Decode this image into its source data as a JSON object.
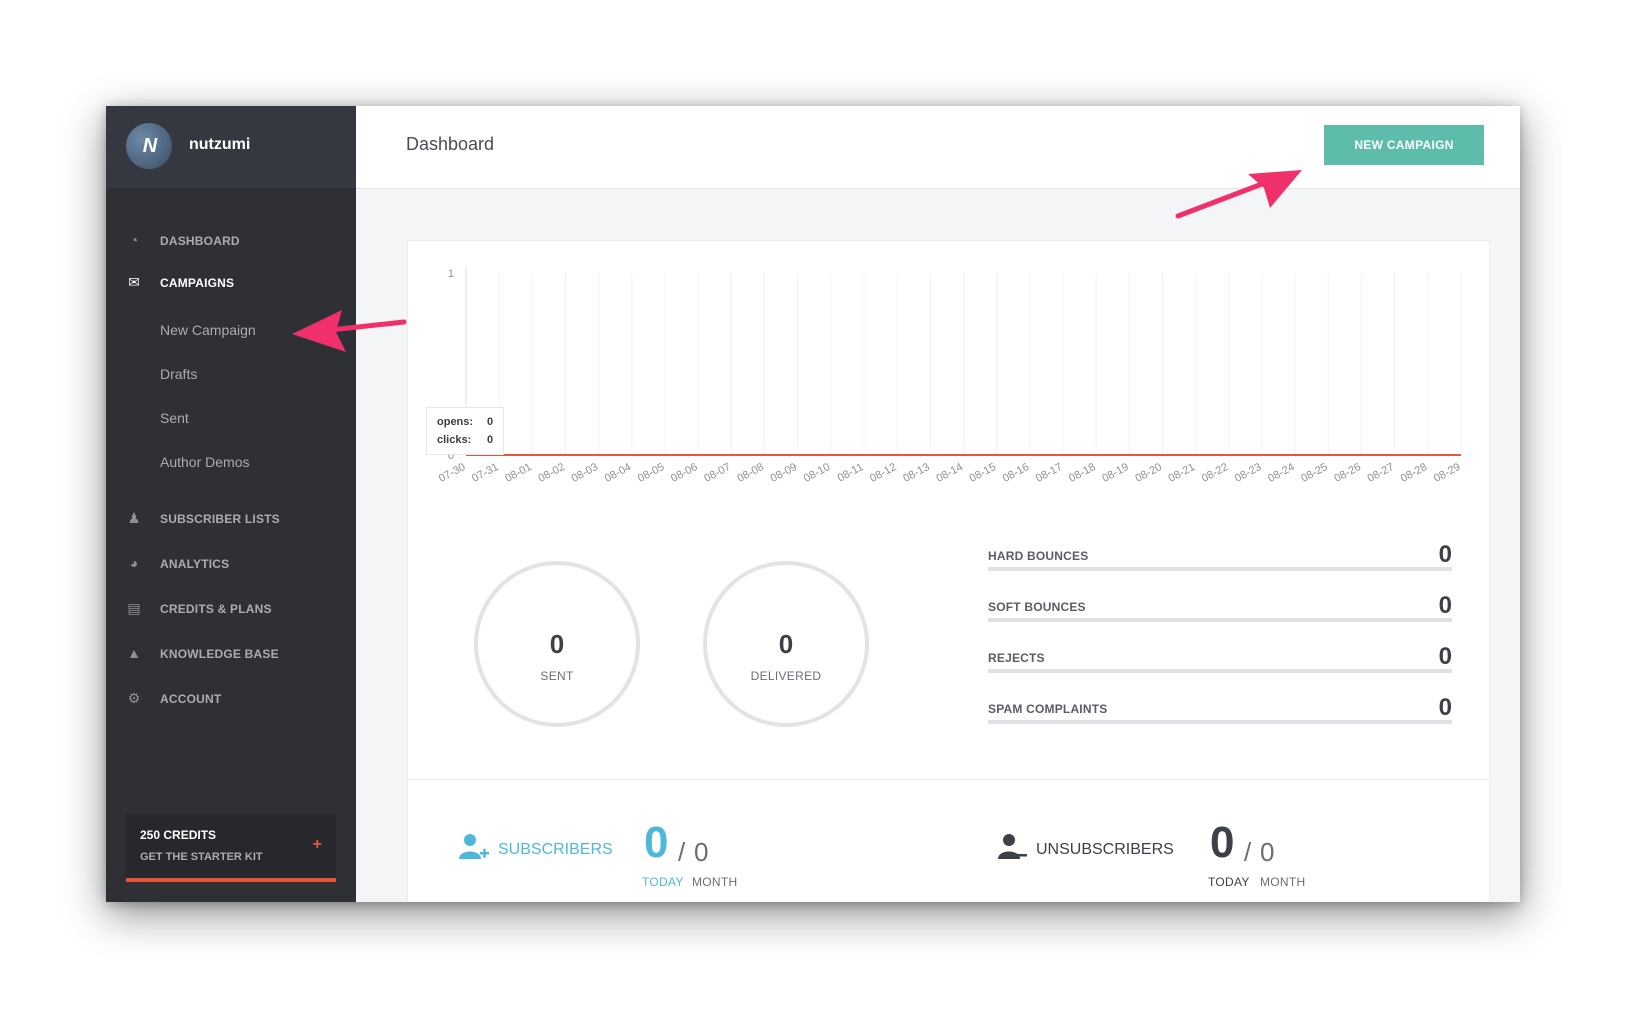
{
  "brand": {
    "logo_text": "N",
    "name": "nutzumi"
  },
  "sidebar": {
    "items": [
      {
        "icon": "dashboard-icon",
        "glyph": "◔",
        "label": "DASHBOARD"
      },
      {
        "icon": "envelope-icon",
        "glyph": "✉",
        "label": "CAMPAIGNS"
      },
      {
        "icon": "users-icon",
        "glyph": "♟",
        "label": "SUBSCRIBER LISTS"
      },
      {
        "icon": "pie-chart-icon",
        "glyph": "◕",
        "label": "ANALYTICS"
      },
      {
        "icon": "wallet-icon",
        "glyph": "▤",
        "label": "CREDITS & PLANS"
      },
      {
        "icon": "graduation-cap-icon",
        "glyph": "▲",
        "label": "KNOWLEDGE BASE"
      },
      {
        "icon": "gear-icon",
        "glyph": "⚙",
        "label": "ACCOUNT"
      }
    ],
    "campaign_subitems": [
      "New Campaign",
      "Drafts",
      "Sent",
      "Author Demos"
    ],
    "credits": {
      "title": "250 CREDITS",
      "subtitle": "GET THE STARTER KIT",
      "plus": "+"
    }
  },
  "header": {
    "title": "Dashboard",
    "new_campaign_label": "NEW CAMPAIGN"
  },
  "chart_data": {
    "type": "line",
    "categories": [
      "07-30",
      "07-31",
      "08-01",
      "08-02",
      "08-03",
      "08-04",
      "08-05",
      "08-06",
      "08-07",
      "08-08",
      "08-09",
      "08-10",
      "08-11",
      "08-12",
      "08-13",
      "08-14",
      "08-15",
      "08-16",
      "08-17",
      "08-18",
      "08-19",
      "08-20",
      "08-21",
      "08-22",
      "08-23",
      "08-24",
      "08-25",
      "08-26",
      "08-27",
      "08-28",
      "08-29"
    ],
    "series": [
      {
        "name": "opens",
        "values": [
          0,
          0,
          0,
          0,
          0,
          0,
          0,
          0,
          0,
          0,
          0,
          0,
          0,
          0,
          0,
          0,
          0,
          0,
          0,
          0,
          0,
          0,
          0,
          0,
          0,
          0,
          0,
          0,
          0,
          0,
          0
        ]
      },
      {
        "name": "clicks",
        "values": [
          0,
          0,
          0,
          0,
          0,
          0,
          0,
          0,
          0,
          0,
          0,
          0,
          0,
          0,
          0,
          0,
          0,
          0,
          0,
          0,
          0,
          0,
          0,
          0,
          0,
          0,
          0,
          0,
          0,
          0,
          0
        ]
      }
    ],
    "yticks": [
      "1",
      "0"
    ],
    "ylim": [
      0,
      1
    ],
    "line_color": "#e9553b",
    "tooltip": {
      "opens_label": "opens:",
      "opens_value": "0",
      "clicks_label": "clicks:",
      "clicks_value": "0"
    }
  },
  "totals": {
    "sent": {
      "value": "0",
      "label": "SENT"
    },
    "delivered": {
      "value": "0",
      "label": "DELIVERED"
    }
  },
  "stats": [
    {
      "label": "HARD BOUNCES",
      "value": "0"
    },
    {
      "label": "SOFT BOUNCES",
      "value": "0"
    },
    {
      "label": "REJECTS",
      "value": "0"
    },
    {
      "label": "SPAM COMPLAINTS",
      "value": "0"
    }
  ],
  "subscribers": {
    "title": "SUBSCRIBERS",
    "today": "0",
    "month": "0",
    "slash": "/",
    "today_label": "TODAY",
    "month_label": "MONTH"
  },
  "unsubscribers": {
    "title": "UNSUBSCRIBERS",
    "today": "0",
    "month": "0",
    "slash": "/",
    "today_label": "TODAY",
    "month_label": "MONTH"
  },
  "colors": {
    "accent": "#5ebcab",
    "highlight": "#4fb8d9",
    "annotation": "#f0306a",
    "sidebar": "#2e3035"
  }
}
